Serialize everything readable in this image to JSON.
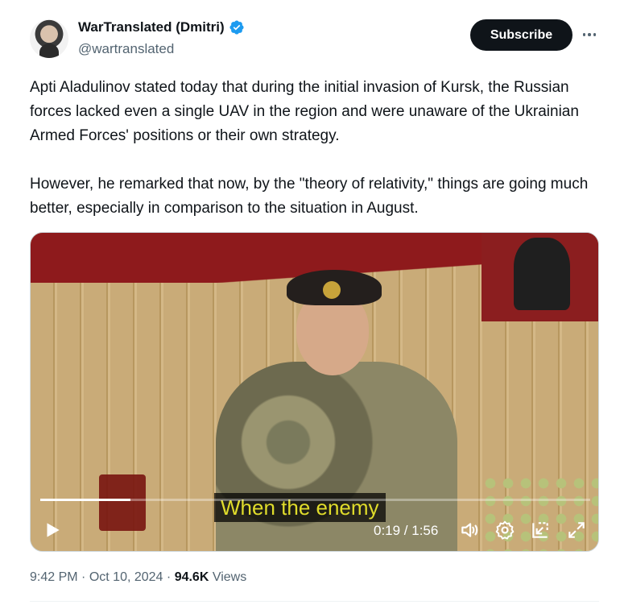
{
  "author": {
    "name": "WarTranslated (Dmitri)",
    "handle": "@wartranslated",
    "verified_icon": "verified-badge-icon"
  },
  "actions": {
    "subscribe_label": "Subscribe"
  },
  "tweet": {
    "paragraph1": "Apti Aladulinov stated today that during the initial invasion of Kursk, the Russian forces lacked even a single UAV in the region and were unaware of the Ukrainian Armed Forces' positions or their own strategy.",
    "paragraph2": "However, he remarked that now, by the \"theory of relativity,\" things are going much better, especially in comparison to the situation in August."
  },
  "video": {
    "subtitle": "When the enemy",
    "time_display": "0:19 / 1:56",
    "progress_fraction": 0.164
  },
  "meta": {
    "time": "9:42 PM",
    "date": "Oct 10, 2024",
    "views_count": "94.6K",
    "views_label": "Views",
    "separator": "·"
  },
  "colors": {
    "verified_blue": "#1d9bf0",
    "subtitle_yellow": "#e0dc2b"
  }
}
